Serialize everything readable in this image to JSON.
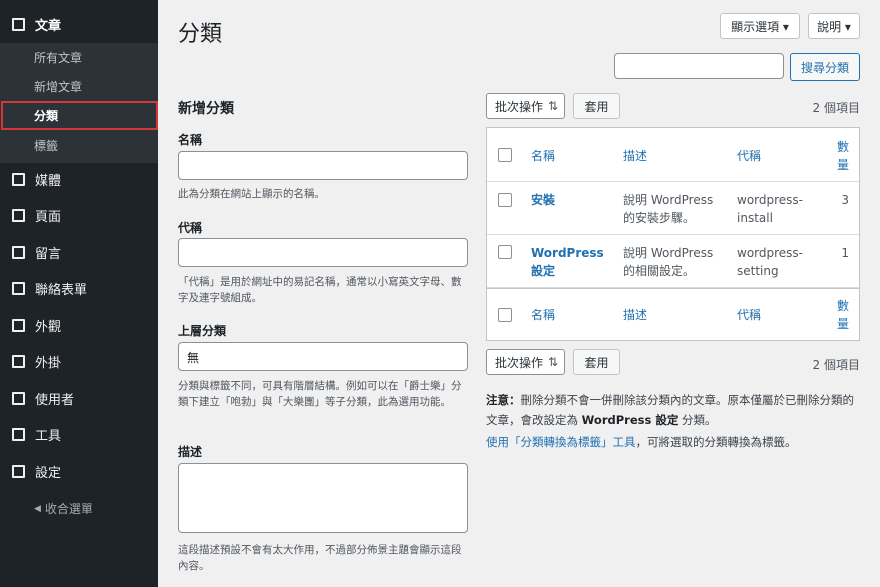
{
  "sidebar": {
    "top_items": [
      {
        "label": "文章",
        "icon": "posts-icon"
      },
      {
        "label": "媒體",
        "icon": "media-icon"
      },
      {
        "label": "頁面",
        "icon": "pages-icon"
      },
      {
        "label": "留言",
        "icon": "comments-icon"
      },
      {
        "label": "聯絡表單",
        "icon": "contact-form-icon"
      },
      {
        "label": "外觀",
        "icon": "appearance-icon"
      },
      {
        "label": "外掛",
        "icon": "plugins-icon"
      },
      {
        "label": "使用者",
        "icon": "users-icon"
      },
      {
        "label": "工具",
        "icon": "tools-icon"
      },
      {
        "label": "設定",
        "icon": "settings-icon"
      }
    ],
    "sub_items": [
      {
        "label": "所有文章"
      },
      {
        "label": "新增文章"
      },
      {
        "label": "分類"
      },
      {
        "label": "標籤"
      }
    ],
    "collapse_icon": "◀",
    "collapse_label": "收合選單"
  },
  "header": {
    "title": "分類",
    "screen_options": "顯示選項 ▾",
    "help": "說明 ▾",
    "search_button": "搜尋分類",
    "search_value": ""
  },
  "form": {
    "title": "新增分類",
    "name_label": "名稱",
    "name_value": "",
    "name_help": "此為分類在網站上顯示的名稱。",
    "slug_label": "代稱",
    "slug_value": "",
    "slug_help": "「代稱」是用於網址中的易記名稱，通常以小寫英文字母、數字及連字號組成。",
    "parent_label": "上層分類",
    "parent_value": "無",
    "parent_help": "分類與標籤不同，可具有階層結構。例如可以在「爵士樂」分類下建立「咆勃」與「大樂團」等子分類，此為選用功能。",
    "desc_label": "描述",
    "desc_value": "",
    "desc_help": "這段描述預設不會有太大作用，不過部分佈景主題會顯示這段內容。"
  },
  "table": {
    "bulk_label": "批次操作",
    "bulk_icon": "⇅",
    "apply_label": "套用",
    "count_text": "2 個項目",
    "columns": {
      "name": "名稱",
      "description": "描述",
      "slug": "代稱",
      "count_line1": "數",
      "count_line2": "量"
    },
    "rows": [
      {
        "name_line1": "安裝",
        "name_line2": "",
        "desc_line1": "說明 WordPress",
        "desc_line2": "的安裝步驟。",
        "slug_line1": "wordpress-",
        "slug_line2": "install",
        "count": "3"
      },
      {
        "name_line1": "WordPress",
        "name_line2": "設定",
        "desc_line1": "說明 WordPress",
        "desc_line2": "的相關設定。",
        "slug_line1": "wordpress-",
        "slug_line2": "setting",
        "count": "1"
      }
    ]
  },
  "note": {
    "prefix": "注意：",
    "text1": "刪除分類不會一併刪除該分類內的文章。原本僅屬於已刪除分類的文章，會改設定為 ",
    "default_cat": "WordPress 設定",
    "text2": " 分類。",
    "link": "使用「分類轉換為標籤」工具",
    "link_suffix": "，可將選取的分類轉換為標籤。"
  },
  "colors": {
    "sidebar_bg": "#1d2327",
    "submenu_bg": "#2c3338",
    "accent": "#2271b1",
    "highlight": "#d63638",
    "page_bg": "#f0f0f1"
  }
}
